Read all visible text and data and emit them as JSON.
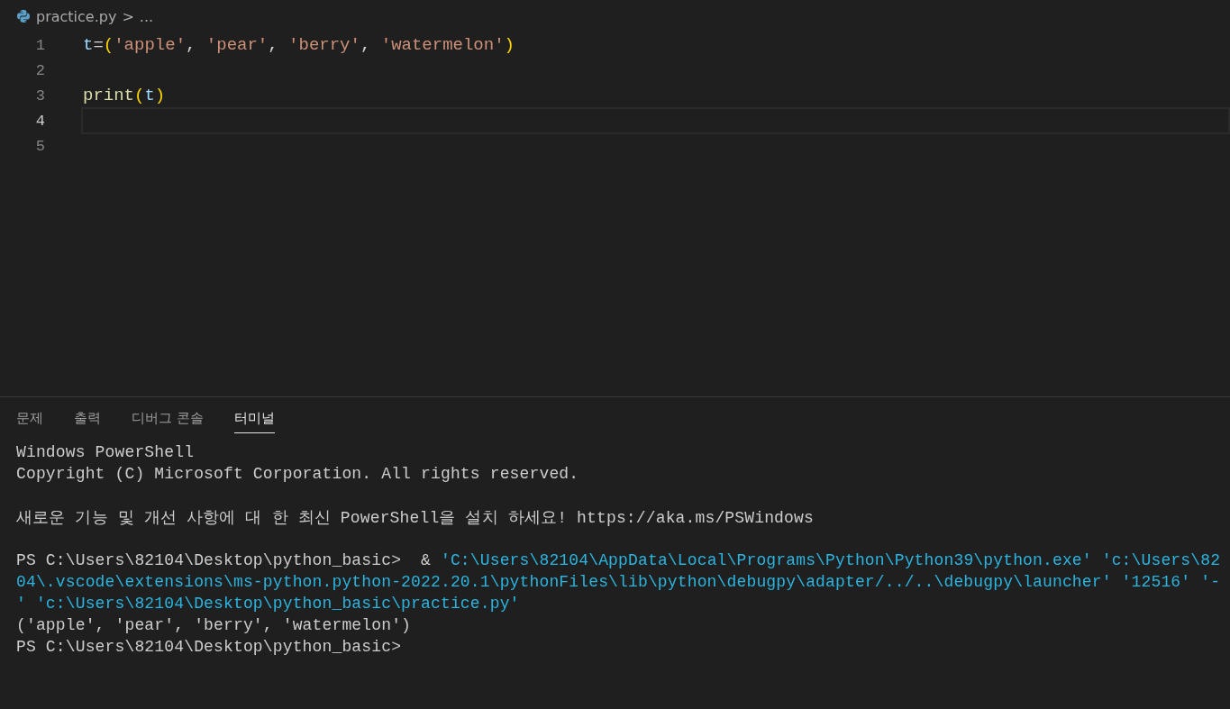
{
  "breadcrumb": {
    "file": "practice.py",
    "separator": ">",
    "more": "..."
  },
  "editor": {
    "lines": [
      {
        "number": "1",
        "current": false,
        "tokens": [
          {
            "kind": "variable",
            "text": "t"
          },
          {
            "kind": "operator",
            "text": "="
          },
          {
            "kind": "bracket",
            "text": "("
          },
          {
            "kind": "string",
            "text": "'apple'"
          },
          {
            "kind": "punct",
            "text": ", "
          },
          {
            "kind": "string",
            "text": "'pear'"
          },
          {
            "kind": "punct",
            "text": ", "
          },
          {
            "kind": "string",
            "text": "'berry'"
          },
          {
            "kind": "punct",
            "text": ", "
          },
          {
            "kind": "string",
            "text": "'watermelon'"
          },
          {
            "kind": "bracket",
            "text": ")"
          }
        ]
      },
      {
        "number": "2",
        "current": false
      },
      {
        "number": "3",
        "current": false,
        "tokens": [
          {
            "kind": "function",
            "text": "print"
          },
          {
            "kind": "bracket",
            "text": "("
          },
          {
            "kind": "variable",
            "text": "t"
          },
          {
            "kind": "bracket",
            "text": ")"
          }
        ]
      },
      {
        "number": "4",
        "current": true
      },
      {
        "number": "5",
        "current": false
      }
    ]
  },
  "panel": {
    "tabs": [
      {
        "label": "문제",
        "selected": false
      },
      {
        "label": "출력",
        "selected": false
      },
      {
        "label": "디버그 콘솔",
        "selected": false
      },
      {
        "label": "터미널",
        "selected": true
      }
    ],
    "terminal": [
      {
        "lines": [
          {
            "segments": [
              {
                "kind": "plain",
                "text": "Windows PowerShell"
              }
            ]
          },
          {
            "segments": [
              {
                "kind": "plain",
                "text": "Copyright (C) Microsoft Corporation. All rights reserved."
              }
            ]
          }
        ]
      },
      {
        "lines": [
          {
            "segments": [
              {
                "kind": "plain",
                "text": "새로운 기능 및 개선 사항에 대 한 최신 PowerShell을 설치 하세요! https://aka.ms/PSWindows"
              }
            ]
          }
        ]
      },
      {
        "lines": [
          {
            "segments": [
              {
                "kind": "plain",
                "text": "PS C:\\Users\\82104\\Desktop\\python_basic>  & "
              },
              {
                "kind": "string",
                "text": "'C:\\Users\\82104\\AppData\\Local\\Programs\\Python\\Python39\\python.exe' 'c:\\Users\\82"
              }
            ]
          },
          {
            "segments": [
              {
                "kind": "string",
                "text": "04\\.vscode\\extensions\\ms-python.python-2022.20.1\\pythonFiles\\lib\\python\\debugpy\\adapter/../..\\debugpy\\launcher' '12516' '-"
              }
            ]
          },
          {
            "segments": [
              {
                "kind": "string",
                "text": "' 'c:\\Users\\82104\\Desktop\\python_basic\\practice.py'"
              }
            ]
          },
          {
            "segments": [
              {
                "kind": "plain",
                "text": "('apple', 'pear', 'berry', 'watermelon')"
              }
            ]
          },
          {
            "segments": [
              {
                "kind": "plain",
                "text": "PS C:\\Users\\82104\\Desktop\\python_basic>"
              }
            ]
          }
        ]
      }
    ]
  }
}
